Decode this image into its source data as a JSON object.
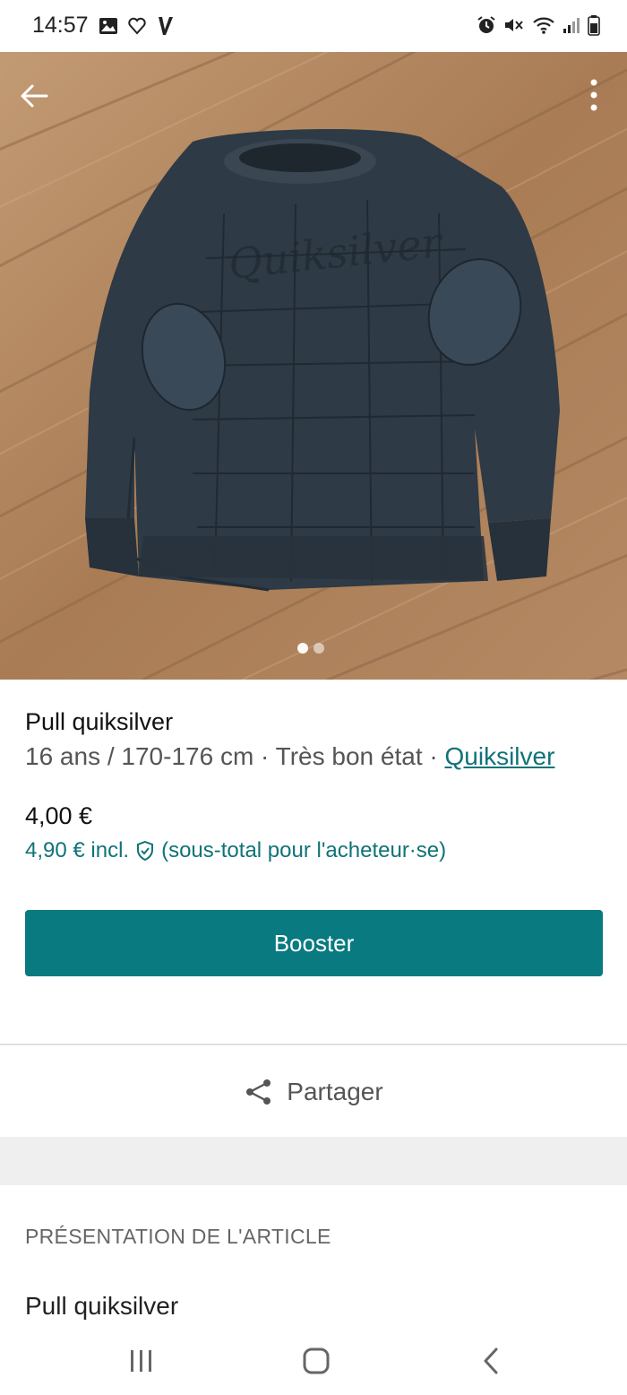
{
  "status_bar": {
    "time": "14:57",
    "icons_left": [
      "gallery-icon",
      "heart-outline-icon",
      "vinted-v-icon"
    ],
    "icons_right": [
      "alarm-icon",
      "mute-icon",
      "wifi-icon",
      "signal-icon",
      "battery-icon"
    ]
  },
  "item": {
    "title": "Pull quiksilver",
    "size": "16 ans / 170-176 cm",
    "separator": " · ",
    "condition": "Très bon état",
    "brand": "Quiksilver",
    "price": "4,00 €",
    "price_incl": "4,90 € incl.",
    "price_incl_note": "(sous-total pour l'acheteur·se)",
    "photo_count": 2,
    "photo_index": 1
  },
  "actions": {
    "boost_label": "Booster",
    "share_label": "Partager"
  },
  "details": {
    "section_title": "PRÉSENTATION DE L'ARTICLE",
    "description": "Pull quiksilver"
  },
  "colors": {
    "accent": "#087a80",
    "link": "#0f7378"
  }
}
